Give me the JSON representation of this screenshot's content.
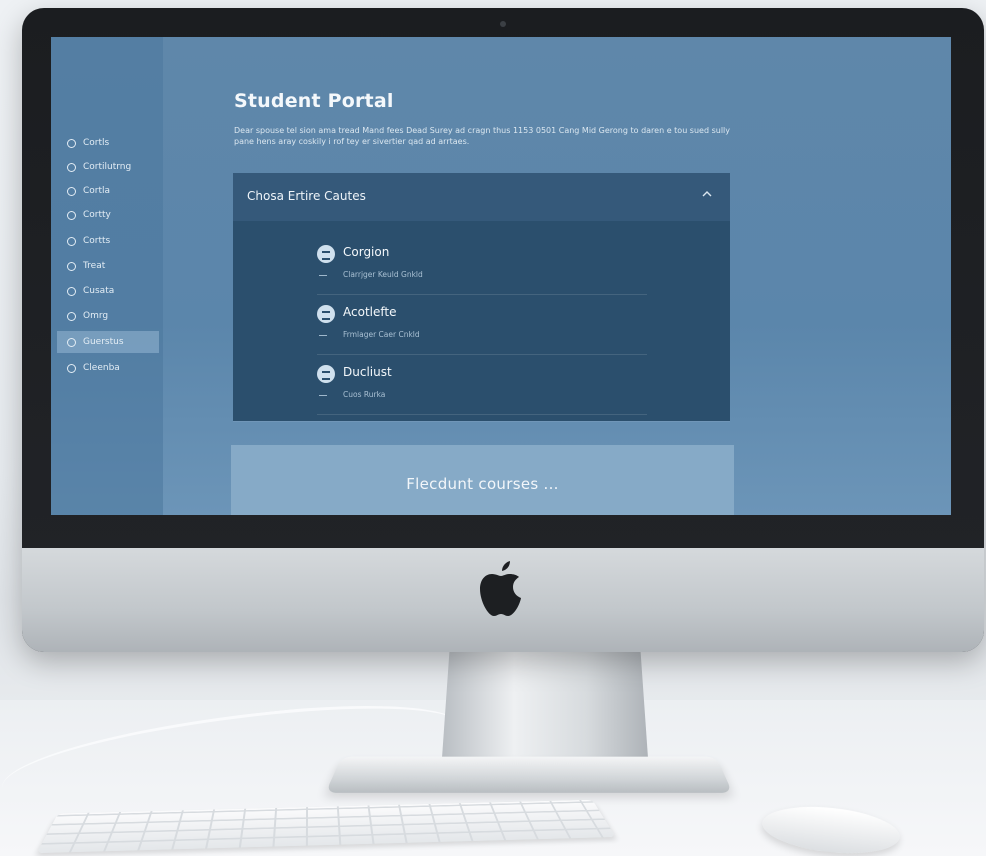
{
  "portal": {
    "title": "Student Portal",
    "description": "Dear spouse tel sion ama tread Mand fees Dead Surey ad cragn thus 1153 0501 Cang Mid Gerong to daren e tou sued sully pane hens aray coskily i rof tey er sivertier qad ad arrtaes.",
    "sidebar": {
      "items": [
        {
          "label": "Cortls",
          "icon": "grid-icon"
        },
        {
          "label": "Cortilutrng",
          "icon": "circle-icon"
        },
        {
          "label": "Cortla",
          "icon": "link-icon"
        },
        {
          "label": "Cortty",
          "icon": "chart-icon"
        },
        {
          "label": "Cortts",
          "icon": "circle-icon"
        },
        {
          "label": "Treat",
          "icon": "circle-icon"
        },
        {
          "label": "Cusata",
          "icon": "circle-icon"
        },
        {
          "label": "Omrg",
          "icon": "circle-icon"
        },
        {
          "label": "Guerstus",
          "icon": "circle-icon",
          "active": true
        },
        {
          "label": "Cleenba",
          "icon": "circle-icon"
        }
      ]
    },
    "panel": {
      "title": "Chosa Ertire Cautes",
      "courses": [
        {
          "name": "Corgion",
          "sub": "Clarrjger Keuld Gnkld"
        },
        {
          "name": "Acotlefte",
          "sub": "Frmlager Caer Cnkld"
        },
        {
          "name": "Ducliust",
          "sub": "Cuos Rurka"
        }
      ]
    },
    "bottom_card": {
      "text": "Flecdunt courses ..."
    }
  },
  "colors": {
    "screen_bg": "#5f87aa",
    "panel_bg": "#2b4f6d",
    "sidebar_active": "#96b7d4",
    "bottom_card": "#86aac7"
  }
}
